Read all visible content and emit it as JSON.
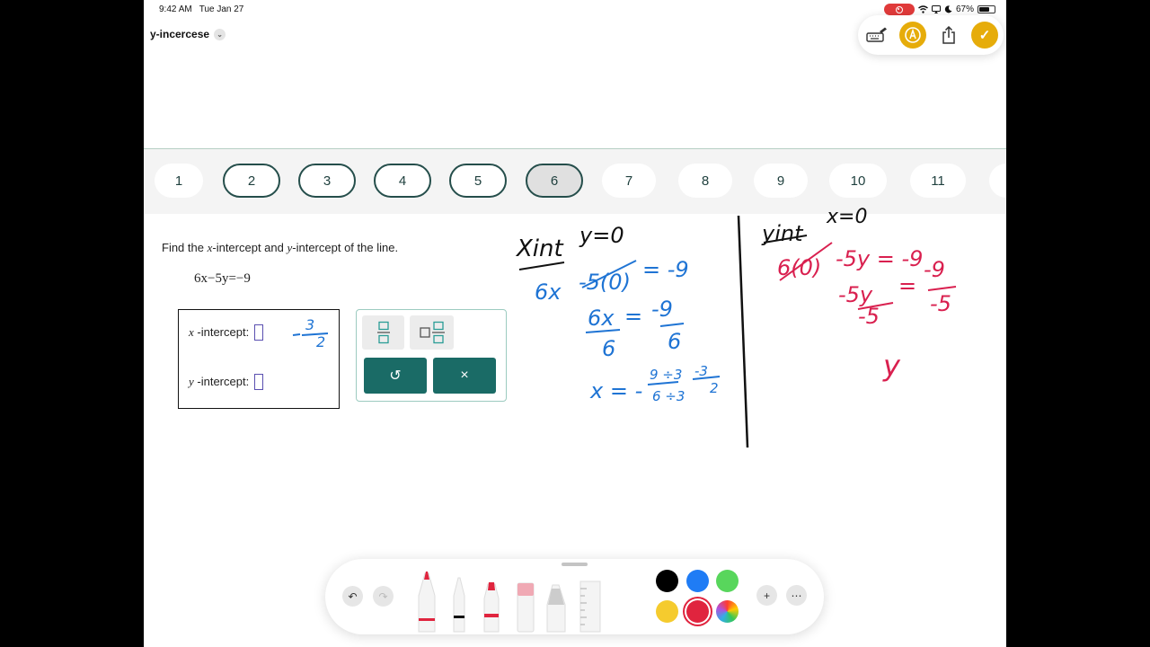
{
  "status": {
    "time": "9:42 AM",
    "date": "Tue Jan 27",
    "battery": "67%",
    "battery_level": 0.67
  },
  "document": {
    "title": "y-incercese"
  },
  "problem_nav": {
    "numbers": [
      "1",
      "2",
      "3",
      "4",
      "5",
      "6",
      "7",
      "8",
      "9",
      "10",
      "11"
    ],
    "current": "6"
  },
  "problem": {
    "prompt_pre": "Find the ",
    "x_var": "x",
    "prompt_mid": "-intercept and ",
    "y_var": "y",
    "prompt_post": "-intercept of the line.",
    "equation": "6x−5y=−9",
    "x_label_var": "x",
    "x_label_text": " -intercept:",
    "y_label_var": "y",
    "y_label_text": " -intercept:"
  },
  "palette": {
    "undo_glyph": "↺",
    "clear_glyph": "×"
  },
  "handwriting": {
    "left_heading_a": "Xint",
    "left_heading_b": "y=0",
    "left_line1_a": "6x",
    "left_line1_b": "-5(0)",
    "left_line1_c": "= -9",
    "left_line2_num_a": "6x",
    "left_line2_eq": "=",
    "left_line2_num_b": "-9",
    "left_line2_den_a": "6",
    "left_line2_den_b": "6",
    "left_line3_lhs": "x = -",
    "left_line3_num": "9 ÷3",
    "left_line3_den": "6 ÷3",
    "left_line3_ans_num": "-3",
    "left_line3_ans_den": "2",
    "side_answer_num": "3",
    "side_answer_den": "2",
    "right_heading_a": "yint",
    "right_heading_b": "x=0",
    "right_line1_a": "6(0)",
    "right_line1_b": "-5y = -9",
    "right_line2_num_a": "-5y",
    "right_line2_eq": "=",
    "right_line2_num_b": "-9",
    "right_line2_den_a": "-5",
    "right_line2_den_b": "-5",
    "right_line3": "y"
  },
  "drawing_tools": {
    "colors": [
      "#000000",
      "#1f7cf5",
      "#58d65c",
      "#f5cb2e",
      "#e0243e"
    ],
    "selected_color": "#e0243e"
  }
}
